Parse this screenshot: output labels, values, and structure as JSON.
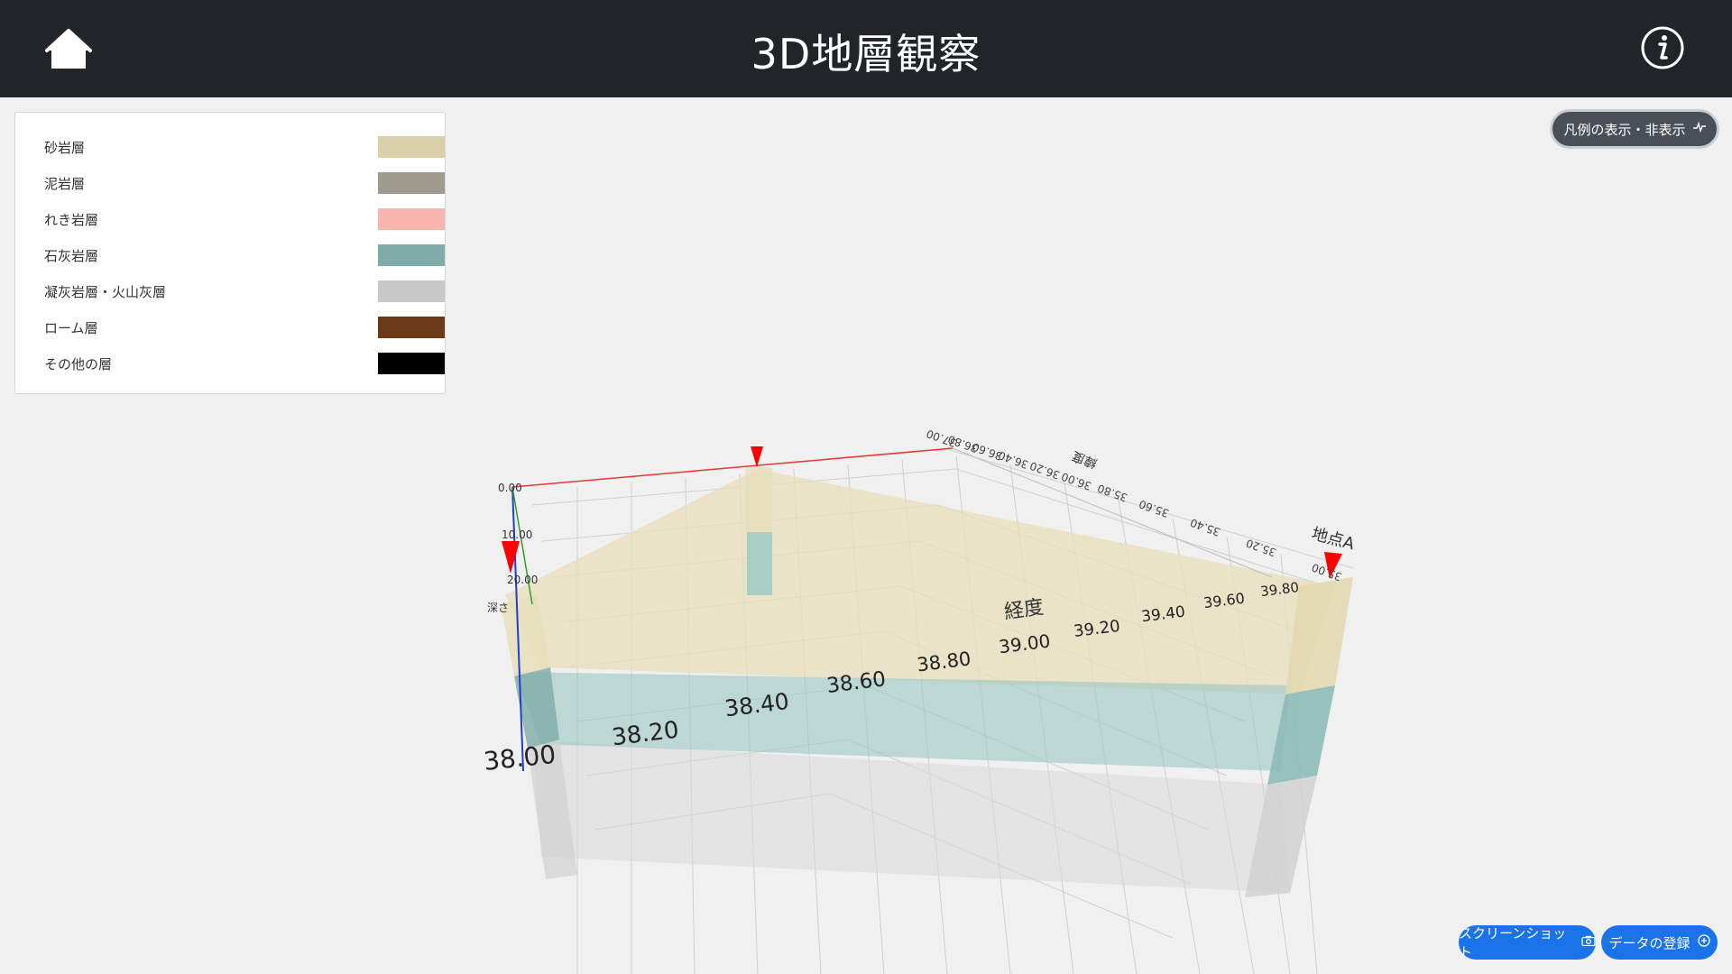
{
  "header": {
    "title": "3D地層観察",
    "home_icon": "home-icon",
    "info_icon": "info-icon"
  },
  "legend": {
    "items": [
      {
        "label": "砂岩層",
        "color": "#d9cfa8"
      },
      {
        "label": "泥岩層",
        "color": "#a09b8f"
      },
      {
        "label": "れき岩層",
        "color": "#f7b5ae"
      },
      {
        "label": "石灰岩層",
        "color": "#7faba8"
      },
      {
        "label": "凝灰岩層・火山灰層",
        "color": "#c8c8c8"
      },
      {
        "label": "ローム層",
        "color": "#6d3a17"
      },
      {
        "label": "その他の層",
        "color": "#000000"
      }
    ]
  },
  "legend_toggle": {
    "label": "凡例の表示・非表示",
    "icon": "pulse-icon"
  },
  "buttons": {
    "screenshot": {
      "label": "スクリーンショット",
      "icon": "camera-icon"
    },
    "register": {
      "label": "データの登録",
      "icon": "plus-circle-icon"
    }
  },
  "scene": {
    "longitude_label": "経度",
    "longitude_ticks": [
      "38.00",
      "38.20",
      "38.40",
      "38.60",
      "38.80",
      "39.00",
      "39.20",
      "39.40",
      "39.60",
      "39.80"
    ],
    "latitude_label": "緯度",
    "latitude_ticks": [
      "35.00",
      "35.20",
      "35.40",
      "35.60",
      "35.80",
      "36.00",
      "36.20",
      "36.40",
      "36.60",
      "36.80",
      "37.00"
    ],
    "depth_label": "深さ",
    "depth_ticks": [
      "0.00",
      "10.00",
      "20.00"
    ],
    "point_label": "地点A",
    "colors": {
      "sandstone": "#e8dfbb",
      "limestone": "#9fc9c5",
      "lower": "#d8d8d8",
      "marker": "#ff0000",
      "axis_red": "#e53935",
      "axis_blue": "#1f3fd1",
      "axis_green": "#2e9e2e"
    }
  }
}
